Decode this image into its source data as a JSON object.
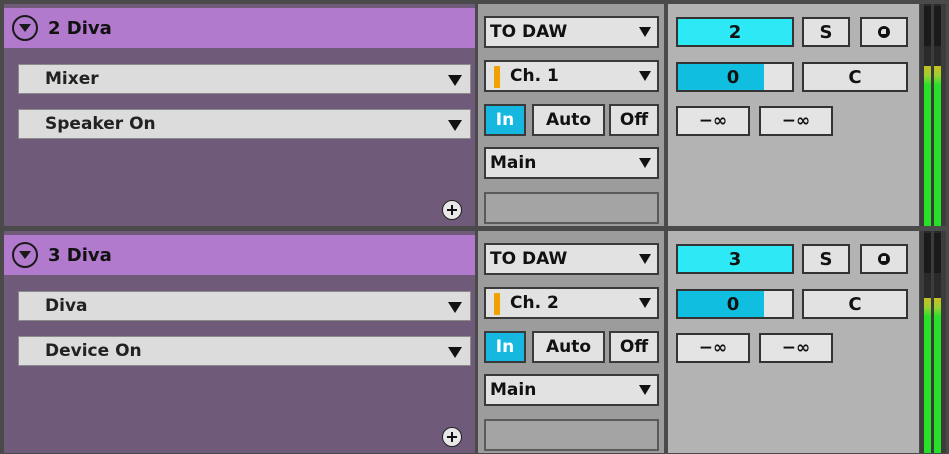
{
  "tracks": [
    {
      "name": "2 Diva",
      "device_chooser": "Mixer",
      "param_chooser": "Speaker On",
      "midi_from": "TO DAW",
      "midi_channel": "Ch. 1",
      "monitor": [
        "In",
        "Auto",
        "Off"
      ],
      "monitor_active": "In",
      "output": "Main",
      "track_number": "2",
      "solo": "S",
      "volume": "0",
      "volume_level": 0.75,
      "pan": "C",
      "send_a": "−∞",
      "send_b": "−∞",
      "meter_level": 0.72
    },
    {
      "name": "3 Diva",
      "device_chooser": "Diva",
      "param_chooser": "Device On",
      "midi_from": "TO DAW",
      "midi_channel": "Ch. 2",
      "monitor": [
        "In",
        "Auto",
        "Off"
      ],
      "monitor_active": "In",
      "output": "Main",
      "track_number": "3",
      "solo": "S",
      "volume": "0",
      "volume_level": 0.75,
      "pan": "C",
      "send_a": "−∞",
      "send_b": "−∞",
      "meter_level": 0.7
    }
  ],
  "colors": {
    "track_title": "#b17acd",
    "track_body": "#705a7a",
    "accent_cyan": "#2de8f5",
    "monitor_in": "#16b8e0",
    "meter_green": "#28e028",
    "channel_marker": "#f0a000"
  },
  "icons": {
    "fold": "chevron-down-circle-icon",
    "add_device": "plus-circle-icon",
    "cue": "headphone-icon"
  }
}
